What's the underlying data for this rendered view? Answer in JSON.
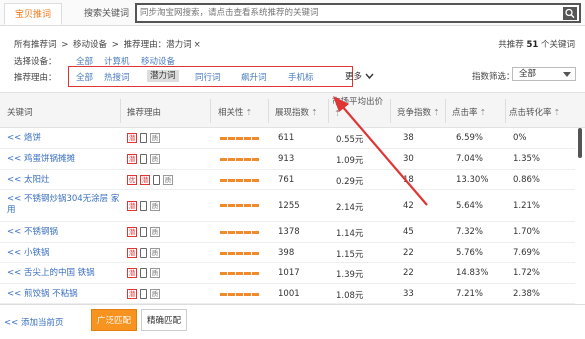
{
  "tabs": [
    {
      "label": "宝贝推词"
    },
    {
      "label": "搜索关键词"
    }
  ],
  "search": {
    "placeholder": "同步淘宝网搜索，请点击查看系统推荐的关键词"
  },
  "breadcrumb": {
    "root": "所有推荐词",
    "sep": ">",
    "device": "移动设备",
    "reason": "推荐理由：潜力词",
    "close": "×"
  },
  "total": {
    "prefix": "共推荐",
    "count": "51",
    "suffix": "个关键词"
  },
  "device_filter": {
    "label": "选择设备：",
    "options": [
      "全部",
      "计算机",
      "移动设备"
    ]
  },
  "reason_filter": {
    "label": "推荐理由：",
    "options": [
      "全部",
      "热搜词",
      "潜力词",
      "同行词",
      "飙升词",
      "手机标"
    ],
    "selected": "潜力词",
    "more": "更多"
  },
  "metric_filter": {
    "label": "指数筛选：",
    "value": "全部"
  },
  "table": {
    "headers": {
      "keyword": "关键词",
      "reason": "推荐理由",
      "relevance": "相关性",
      "impressions": "展现指数",
      "avg_price": "市场平均出价",
      "competition": "竞争指数",
      "ctr": "点击率",
      "cvr": "点击转化率"
    },
    "up_glyph": "⇡",
    "rows": [
      {
        "add": "<<",
        "keyword": "烙饼",
        "badges": [
          "潜",
          "phone",
          "质"
        ],
        "impressions": "611",
        "avg_price": "0.55元",
        "competition": "38",
        "ctr": "6.59%",
        "cvr": "0%"
      },
      {
        "add": "<<",
        "keyword": "鸡蛋饼锅摊摊",
        "badges": [
          "潜",
          "phone",
          "质"
        ],
        "impressions": "913",
        "avg_price": "1.09元",
        "competition": "30",
        "ctr": "7.04%",
        "cvr": "1.35%"
      },
      {
        "add": "<<",
        "keyword": "太阳灶",
        "badges": [
          "优",
          "潜",
          "phone",
          "质"
        ],
        "impressions": "761",
        "avg_price": "0.29元",
        "competition": "18",
        "ctr": "13.30%",
        "cvr": "0.86%"
      },
      {
        "add": "<<",
        "keyword": "不锈钢炒锅304无涂层 家用",
        "badges": [
          "潜",
          "phone",
          "质"
        ],
        "impressions": "1255",
        "avg_price": "2.14元",
        "competition": "42",
        "ctr": "5.64%",
        "cvr": "1.21%"
      },
      {
        "add": "<<",
        "keyword": "不锈钢锅",
        "badges": [
          "潜",
          "phone",
          "质"
        ],
        "impressions": "1378",
        "avg_price": "1.14元",
        "competition": "45",
        "ctr": "7.32%",
        "cvr": "1.70%"
      },
      {
        "add": "<<",
        "keyword": "小铁锅",
        "badges": [
          "潜",
          "phone",
          "质"
        ],
        "impressions": "398",
        "avg_price": "1.15元",
        "competition": "22",
        "ctr": "5.76%",
        "cvr": "7.69%"
      },
      {
        "add": "<<",
        "keyword": "舌尖上的中国 铁锅",
        "badges": [
          "潜",
          "phone",
          "质"
        ],
        "impressions": "1017",
        "avg_price": "1.39元",
        "competition": "22",
        "ctr": "14.83%",
        "cvr": "1.72%"
      },
      {
        "add": "<<",
        "keyword": "煎饺锅 不粘锅",
        "badges": [
          "潜",
          "phone",
          "质"
        ],
        "impressions": "1001",
        "avg_price": "1.08元",
        "competition": "33",
        "ctr": "7.21%",
        "cvr": "2.38%"
      }
    ]
  },
  "footer": {
    "add_page": "<< 添加当前页",
    "broad": "广泛匹配",
    "exact": "精确匹配"
  },
  "colors": {
    "accent": "#f7931e",
    "link": "#3a6fc0",
    "highlight_box": "#e03535"
  }
}
